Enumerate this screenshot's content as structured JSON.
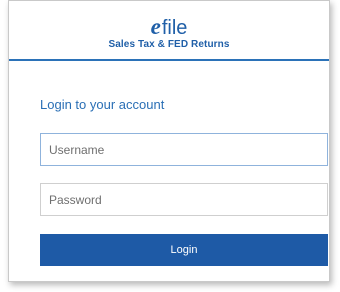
{
  "header": {
    "logo_prefix": "e",
    "logo_text": "file",
    "tagline": "Sales Tax & FED Returns"
  },
  "form": {
    "title": "Login to your account",
    "username_placeholder": "Username",
    "password_placeholder": "Password",
    "login_label": "Login"
  },
  "colors": {
    "brand": "#1f5fa8",
    "button": "#1e5aa6",
    "accent_line": "#2b72b8"
  }
}
